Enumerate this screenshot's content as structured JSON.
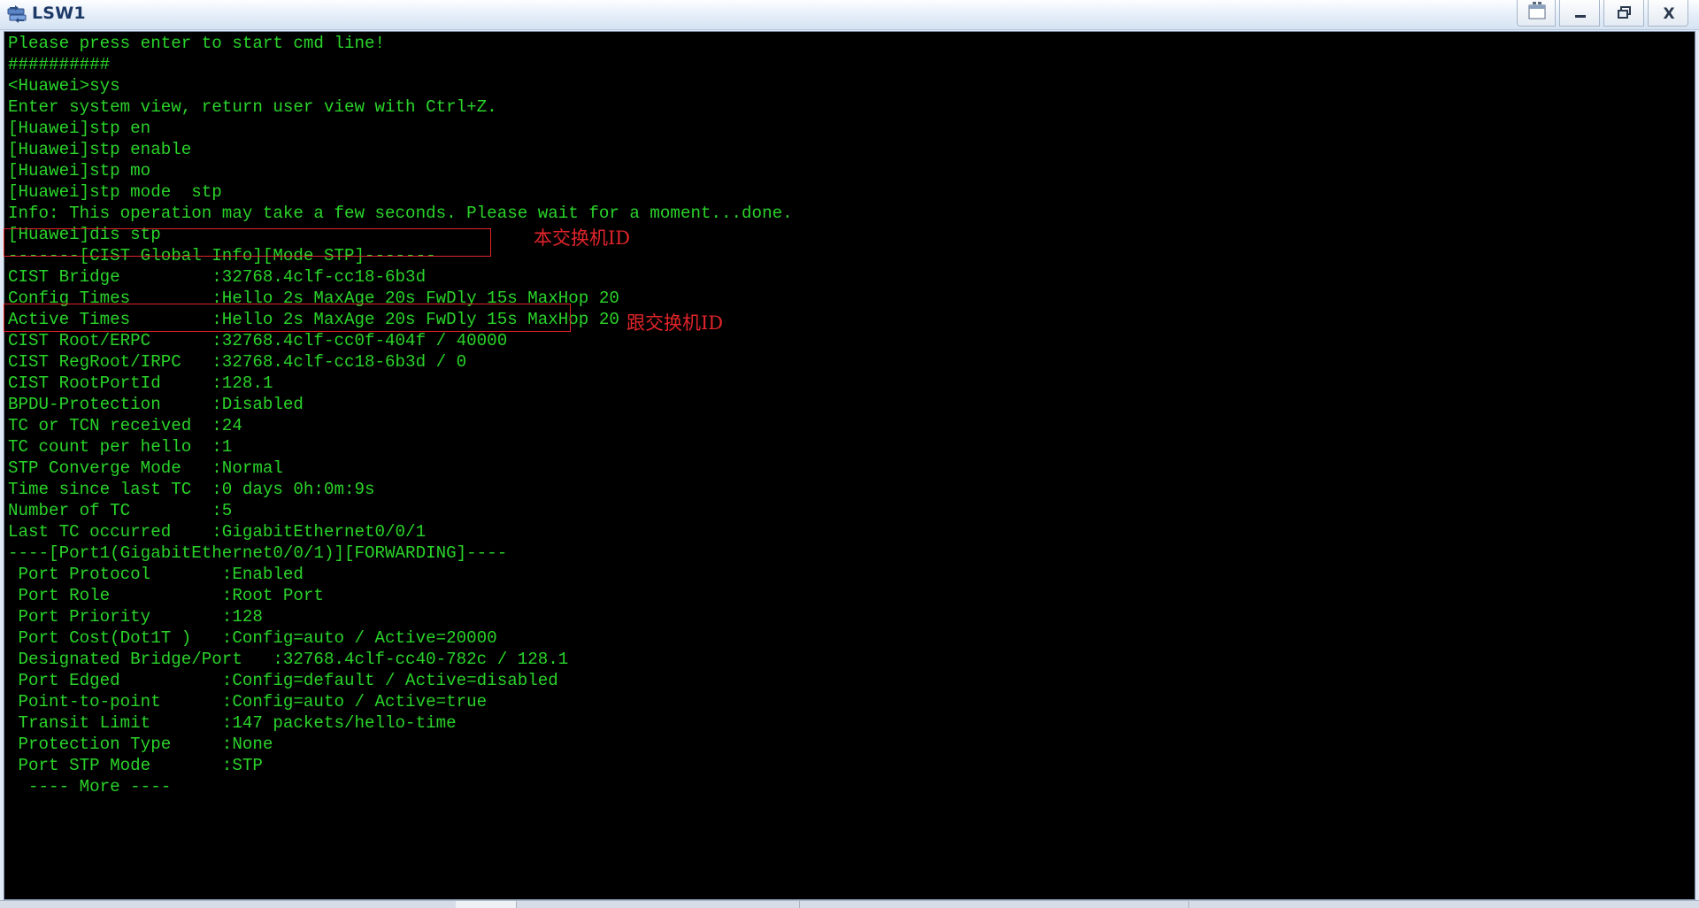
{
  "window": {
    "title": "LSW1",
    "controls": {
      "restore_extra_icon": "restore-window-icon",
      "minimize_icon": "minimize-icon",
      "maximize_icon": "maximize-icon",
      "close_label": "X"
    }
  },
  "terminal": {
    "lines": [
      "Please press enter to start cmd line!",
      "##########",
      "<Huawei>sys",
      "Enter system view, return user view with Ctrl+Z.",
      "[Huawei]stp en",
      "[Huawei]stp enable",
      "[Huawei]stp mo",
      "[Huawei]stp mode  stp",
      "Info: This operation may take a few seconds. Please wait for a moment...done.",
      "[Huawei]dis stp",
      "-------[CIST Global Info][Mode STP]-------",
      "CIST Bridge         :32768.4clf-cc18-6b3d",
      "Config Times        :Hello 2s MaxAge 20s FwDly 15s MaxHop 20",
      "Active Times        :Hello 2s MaxAge 20s FwDly 15s MaxHop 20",
      "CIST Root/ERPC      :32768.4clf-cc0f-404f / 40000",
      "CIST RegRoot/IRPC   :32768.4clf-cc18-6b3d / 0",
      "CIST RootPortId     :128.1",
      "BPDU-Protection     :Disabled",
      "TC or TCN received  :24",
      "TC count per hello  :1",
      "STP Converge Mode   :Normal",
      "Time since last TC  :0 days 0h:0m:9s",
      "Number of TC        :5",
      "Last TC occurred    :GigabitEthernet0/0/1",
      "----[Port1(GigabitEthernet0/0/1)][FORWARDING]----",
      " Port Protocol       :Enabled",
      " Port Role           :Root Port",
      " Port Priority       :128",
      " Port Cost(Dot1T )   :Config=auto / Active=20000",
      " Designated Bridge/Port   :32768.4clf-cc40-782c / 128.1",
      " Port Edged          :Config=default / Active=disabled",
      " Point-to-point      :Config=auto / Active=true",
      " Transit Limit       :147 packets/hello-time",
      " Protection Type     :None",
      " Port STP Mode       :STP",
      "  ---- More ----"
    ]
  },
  "annotations": {
    "note_1": "本交换机ID",
    "note_2": "跟交换机ID",
    "color": "#e0242a"
  },
  "colors": {
    "terminal_bg": "#000000",
    "terminal_text": "#2ad42a"
  }
}
